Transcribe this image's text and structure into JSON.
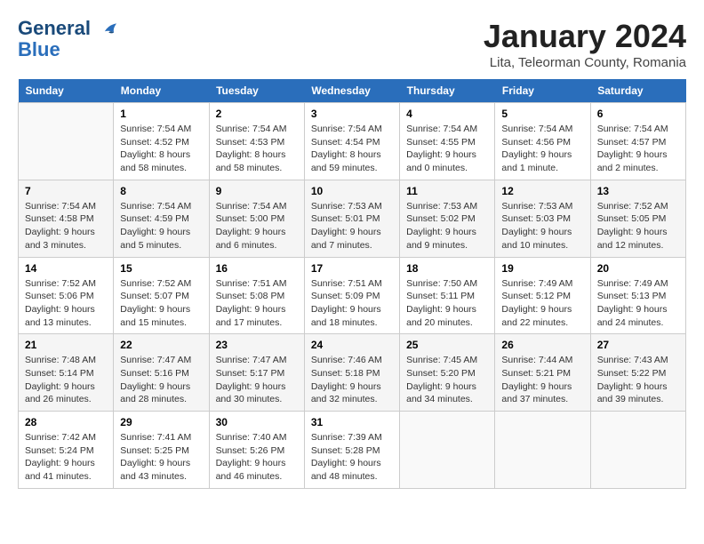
{
  "header": {
    "logo_line1": "General",
    "logo_line2": "Blue",
    "month_title": "January 2024",
    "location": "Lita, Teleorman County, Romania"
  },
  "weekdays": [
    "Sunday",
    "Monday",
    "Tuesday",
    "Wednesday",
    "Thursday",
    "Friday",
    "Saturday"
  ],
  "weeks": [
    [
      {
        "day": "",
        "info": ""
      },
      {
        "day": "1",
        "info": "Sunrise: 7:54 AM\nSunset: 4:52 PM\nDaylight: 8 hours\nand 58 minutes."
      },
      {
        "day": "2",
        "info": "Sunrise: 7:54 AM\nSunset: 4:53 PM\nDaylight: 8 hours\nand 58 minutes."
      },
      {
        "day": "3",
        "info": "Sunrise: 7:54 AM\nSunset: 4:54 PM\nDaylight: 8 hours\nand 59 minutes."
      },
      {
        "day": "4",
        "info": "Sunrise: 7:54 AM\nSunset: 4:55 PM\nDaylight: 9 hours\nand 0 minutes."
      },
      {
        "day": "5",
        "info": "Sunrise: 7:54 AM\nSunset: 4:56 PM\nDaylight: 9 hours\nand 1 minute."
      },
      {
        "day": "6",
        "info": "Sunrise: 7:54 AM\nSunset: 4:57 PM\nDaylight: 9 hours\nand 2 minutes."
      }
    ],
    [
      {
        "day": "7",
        "info": "Sunrise: 7:54 AM\nSunset: 4:58 PM\nDaylight: 9 hours\nand 3 minutes."
      },
      {
        "day": "8",
        "info": "Sunrise: 7:54 AM\nSunset: 4:59 PM\nDaylight: 9 hours\nand 5 minutes."
      },
      {
        "day": "9",
        "info": "Sunrise: 7:54 AM\nSunset: 5:00 PM\nDaylight: 9 hours\nand 6 minutes."
      },
      {
        "day": "10",
        "info": "Sunrise: 7:53 AM\nSunset: 5:01 PM\nDaylight: 9 hours\nand 7 minutes."
      },
      {
        "day": "11",
        "info": "Sunrise: 7:53 AM\nSunset: 5:02 PM\nDaylight: 9 hours\nand 9 minutes."
      },
      {
        "day": "12",
        "info": "Sunrise: 7:53 AM\nSunset: 5:03 PM\nDaylight: 9 hours\nand 10 minutes."
      },
      {
        "day": "13",
        "info": "Sunrise: 7:52 AM\nSunset: 5:05 PM\nDaylight: 9 hours\nand 12 minutes."
      }
    ],
    [
      {
        "day": "14",
        "info": "Sunrise: 7:52 AM\nSunset: 5:06 PM\nDaylight: 9 hours\nand 13 minutes."
      },
      {
        "day": "15",
        "info": "Sunrise: 7:52 AM\nSunset: 5:07 PM\nDaylight: 9 hours\nand 15 minutes."
      },
      {
        "day": "16",
        "info": "Sunrise: 7:51 AM\nSunset: 5:08 PM\nDaylight: 9 hours\nand 17 minutes."
      },
      {
        "day": "17",
        "info": "Sunrise: 7:51 AM\nSunset: 5:09 PM\nDaylight: 9 hours\nand 18 minutes."
      },
      {
        "day": "18",
        "info": "Sunrise: 7:50 AM\nSunset: 5:11 PM\nDaylight: 9 hours\nand 20 minutes."
      },
      {
        "day": "19",
        "info": "Sunrise: 7:49 AM\nSunset: 5:12 PM\nDaylight: 9 hours\nand 22 minutes."
      },
      {
        "day": "20",
        "info": "Sunrise: 7:49 AM\nSunset: 5:13 PM\nDaylight: 9 hours\nand 24 minutes."
      }
    ],
    [
      {
        "day": "21",
        "info": "Sunrise: 7:48 AM\nSunset: 5:14 PM\nDaylight: 9 hours\nand 26 minutes."
      },
      {
        "day": "22",
        "info": "Sunrise: 7:47 AM\nSunset: 5:16 PM\nDaylight: 9 hours\nand 28 minutes."
      },
      {
        "day": "23",
        "info": "Sunrise: 7:47 AM\nSunset: 5:17 PM\nDaylight: 9 hours\nand 30 minutes."
      },
      {
        "day": "24",
        "info": "Sunrise: 7:46 AM\nSunset: 5:18 PM\nDaylight: 9 hours\nand 32 minutes."
      },
      {
        "day": "25",
        "info": "Sunrise: 7:45 AM\nSunset: 5:20 PM\nDaylight: 9 hours\nand 34 minutes."
      },
      {
        "day": "26",
        "info": "Sunrise: 7:44 AM\nSunset: 5:21 PM\nDaylight: 9 hours\nand 37 minutes."
      },
      {
        "day": "27",
        "info": "Sunrise: 7:43 AM\nSunset: 5:22 PM\nDaylight: 9 hours\nand 39 minutes."
      }
    ],
    [
      {
        "day": "28",
        "info": "Sunrise: 7:42 AM\nSunset: 5:24 PM\nDaylight: 9 hours\nand 41 minutes."
      },
      {
        "day": "29",
        "info": "Sunrise: 7:41 AM\nSunset: 5:25 PM\nDaylight: 9 hours\nand 43 minutes."
      },
      {
        "day": "30",
        "info": "Sunrise: 7:40 AM\nSunset: 5:26 PM\nDaylight: 9 hours\nand 46 minutes."
      },
      {
        "day": "31",
        "info": "Sunrise: 7:39 AM\nSunset: 5:28 PM\nDaylight: 9 hours\nand 48 minutes."
      },
      {
        "day": "",
        "info": ""
      },
      {
        "day": "",
        "info": ""
      },
      {
        "day": "",
        "info": ""
      }
    ]
  ]
}
